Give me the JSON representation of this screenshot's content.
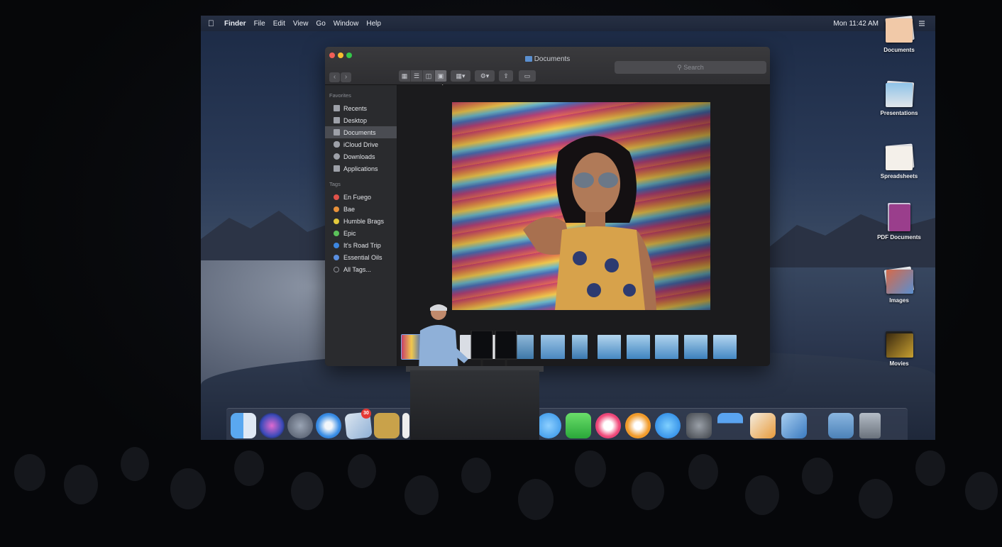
{
  "menubar": {
    "apple_icon": "apple-logo",
    "items": [
      "Finder",
      "File",
      "Edit",
      "View",
      "Go",
      "Window",
      "Help"
    ],
    "clock": "Mon 11:42 AM",
    "status_icons": [
      "search-icon",
      "siri-icon",
      "control-icon"
    ]
  },
  "finder": {
    "title": "Documents",
    "search_placeholder": "Search",
    "sidebar": {
      "favorites_heading": "Favorites",
      "favorites": [
        "Recents",
        "Desktop",
        "Documents",
        "iCloud Drive",
        "Downloads",
        "Applications"
      ],
      "selected": "Documents",
      "tags_heading": "Tags",
      "tags": [
        {
          "label": "En Fuego",
          "color": "#e0524a"
        },
        {
          "label": "Bae",
          "color": "#e8913a"
        },
        {
          "label": "Humble Brags",
          "color": "#e4c93c"
        },
        {
          "label": "Epic",
          "color": "#5bc25a"
        },
        {
          "label": "It's Road Trip",
          "color": "#3c86e0"
        },
        {
          "label": "Essential Oils",
          "color": "#5a8fe0"
        },
        {
          "label": "All Tags...",
          "color": "#8a8c92"
        }
      ]
    },
    "view_mode": "gallery"
  },
  "desktop_stacks": [
    "Documents",
    "Presentations",
    "Spreadsheets",
    "PDF Documents",
    "Images",
    "Movies"
  ],
  "dock": {
    "apps": [
      "finder",
      "siri",
      "launchpad",
      "safari",
      "mail",
      "notes",
      "reminders",
      "messages",
      "facetime",
      "itunes",
      "books",
      "app-store",
      "system-preferences",
      "keynote",
      "pages",
      "xcode",
      "downloads",
      "trash"
    ],
    "mail_badge": "30"
  },
  "colors": {
    "accent": "#3c86e0",
    "window_bg": "#1e1e20",
    "sidebar_bg": "#2a2b2e"
  }
}
